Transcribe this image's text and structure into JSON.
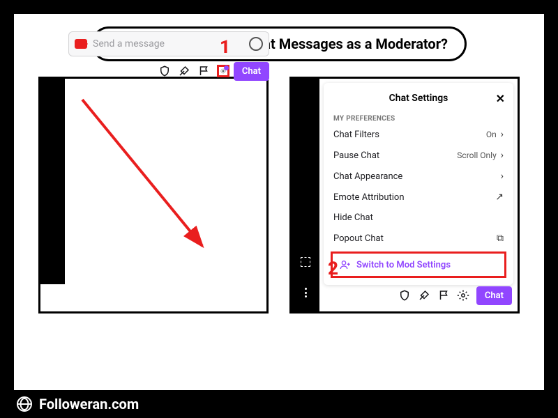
{
  "title": "How to Delete Twitch Chat Messages as a Moderator?",
  "step1": {
    "num": "1",
    "placeholder": "Send a message",
    "chat_button": "Chat"
  },
  "step2": {
    "num": "2",
    "popup_title": "Chat Settings",
    "section": "MY PREFERENCES",
    "items": [
      {
        "label": "Chat Filters",
        "value": "On",
        "icon": "chevron"
      },
      {
        "label": "Pause Chat",
        "value": "Scroll Only",
        "icon": "chevron"
      },
      {
        "label": "Chat Appearance",
        "value": "",
        "icon": "chevron"
      },
      {
        "label": "Emote Attribution",
        "value": "",
        "icon": "arrow-out"
      },
      {
        "label": "Hide Chat",
        "value": "",
        "icon": ""
      },
      {
        "label": "Popout Chat",
        "value": "",
        "icon": "popout"
      }
    ],
    "mod_switch": "Switch to Mod Settings",
    "chat_button": "Chat"
  },
  "footer": {
    "brand": "Followeran.com"
  }
}
